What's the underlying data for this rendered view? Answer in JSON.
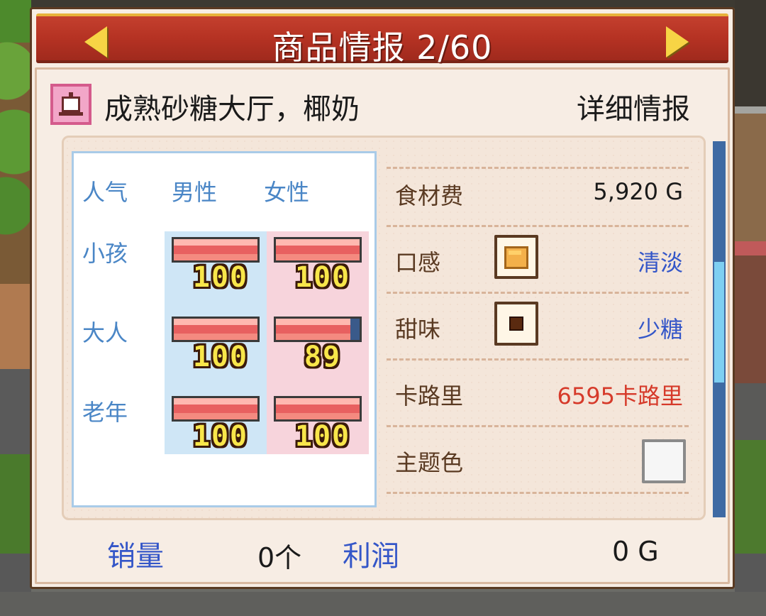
{
  "header": {
    "title": "商品情报 2/60"
  },
  "item": {
    "name": "成熟砂糖大厅，椰奶",
    "detail_label": "详细情报"
  },
  "popularity": {
    "label": "人气",
    "columns": [
      "男性",
      "女性"
    ],
    "rows": [
      {
        "label": "小孩",
        "male": 100,
        "female": 100
      },
      {
        "label": "大人",
        "male": 100,
        "female": 89
      },
      {
        "label": "老年",
        "male": 100,
        "female": 100
      }
    ]
  },
  "stats": {
    "ingredient_cost": {
      "label": "食材费",
      "value": "5,920 G"
    },
    "texture": {
      "label": "口感",
      "value": "清淡"
    },
    "sweetness": {
      "label": "甜味",
      "value": "少糖"
    },
    "calories": {
      "label": "卡路里",
      "value": "6595卡路里"
    },
    "theme_color": {
      "label": "主题色",
      "color": "#f6f6f6"
    }
  },
  "footer": {
    "sales_label": "销量",
    "sales_value": "0个",
    "profit_label": "利润",
    "profit_value": "0 G"
  },
  "colors": {
    "header_red": "#b53223",
    "label_blue": "#4a86c6",
    "calorie_red": "#d63a2a",
    "value_blue": "#3456c8"
  }
}
